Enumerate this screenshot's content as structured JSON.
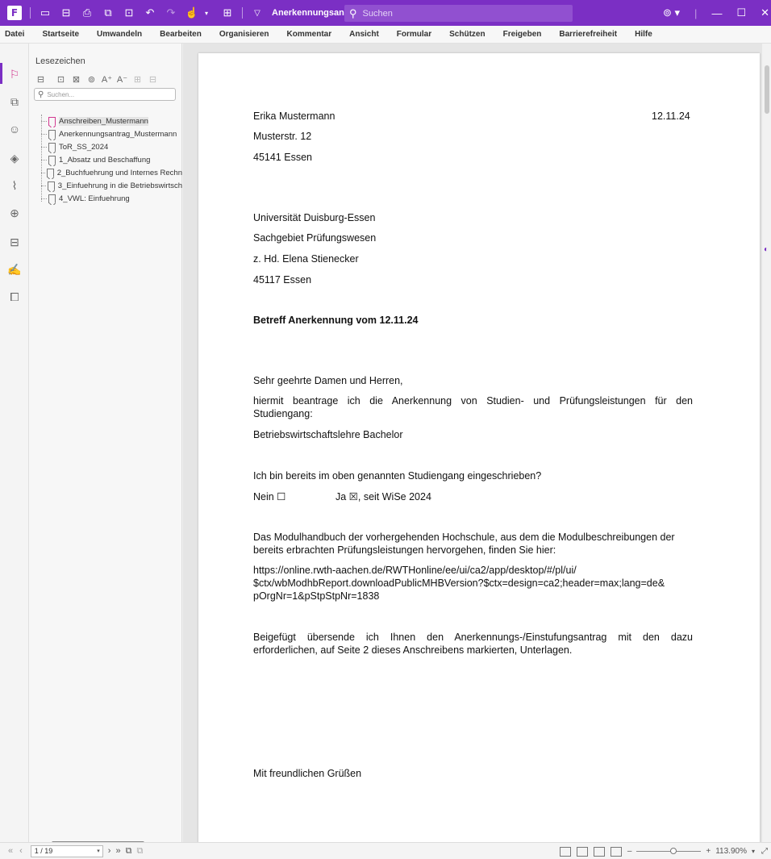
{
  "titlebar": {
    "doc_title": "Anerkennungsantrag Mus...",
    "search_placeholder": "Suchen"
  },
  "menu": [
    "Datei",
    "Startseite",
    "Umwandeln",
    "Bearbeiten",
    "Organisieren",
    "Kommentar",
    "Ansicht",
    "Formular",
    "Schützen",
    "Freigeben",
    "Barrierefreiheit",
    "Hilfe"
  ],
  "panel": {
    "title": "Lesezeichen",
    "search_placeholder": "Suchen...",
    "bookmarks": [
      "Anschreiben_Mustermann",
      "Anerkennungsantrag_Mustermann",
      "ToR_SS_2024",
      "1_Absatz und Beschaffung",
      "2_Buchfuehrung und Internes Rechn",
      "3_Einfuehrung in die Betriebswirtsch",
      "4_VWL: Einfuehrung"
    ]
  },
  "letter": {
    "sender_name": "Erika Mustermann",
    "date": "12.11.24",
    "sender_street": "Musterstr. 12",
    "sender_city": "45141 Essen",
    "recipient_org": "Universität Duisburg-Essen",
    "recipient_dept": "Sachgebiet Prüfungswesen",
    "recipient_attn": "z. Hd. Elena Stienecker",
    "recipient_city": "45117 Essen",
    "subject": "Betreff Anerkennung vom 12.11.24",
    "salutation": "Sehr geehrte Damen und Herren,",
    "para1_line1": "hiermit beantrage ich die Anerkennung von Studien- und Prüfungsleistungen für den",
    "para1_line2": "Studiengang:",
    "program": "Betriebswirtschaftslehre Bachelor",
    "question": "Ich bin bereits im oben genannten Studiengang eingeschrieben?",
    "answer_no": "Nein ☐",
    "answer_yes": "Ja ☒, seit WiSe 2024",
    "para2_line1": "Das Modulhandbuch der vorhergehenden Hochschule, aus dem die Modulbeschreibungen der",
    "para2_line2": "bereits erbrachten Prüfungsleistungen hervorgehen, finden Sie hier:",
    "url_line1": "https://online.rwth-aachen.de/RWTHonline/ee/ui/ca2/app/desktop/#/pl/ui/",
    "url_line2": "$ctx/wbModhbReport.downloadPublicMHBVersion?$ctx=design=ca2;header=max;lang=de&",
    "url_line3": "pOrgNr=1&pStpStpNr=1838",
    "para3_line1": "Beigefügt übersende ich Ihnen den Anerkennungs-/Einstufungsantrag mit den dazu",
    "para3_line2": "erforderlichen, auf Seite 2 dieses Anschreibens markierten, Unterlagen.",
    "closing": "Mit freundlichen Grüßen"
  },
  "status": {
    "page": "1 / 19",
    "zoom": "113.90%"
  }
}
